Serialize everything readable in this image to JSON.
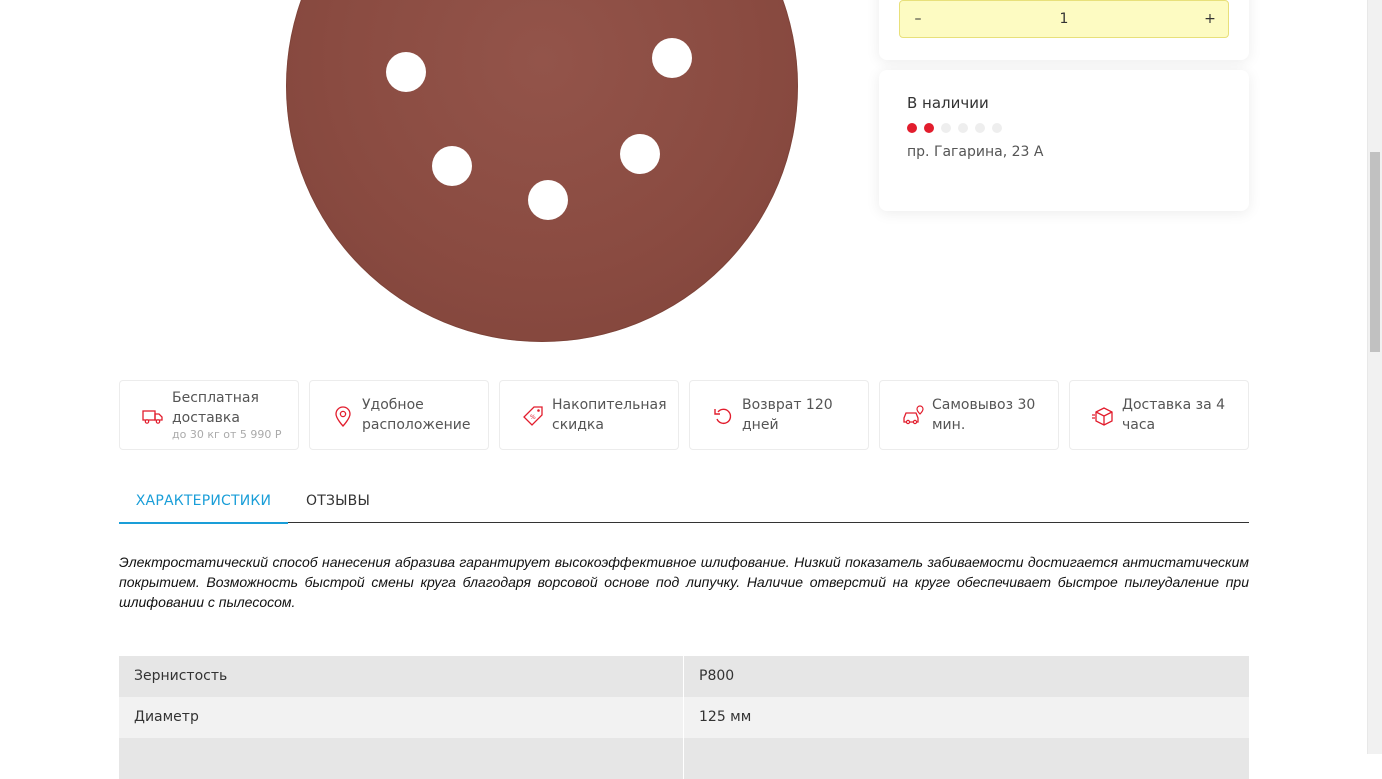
{
  "quantity": {
    "minus_label": "–",
    "value": "1",
    "plus_label": "+"
  },
  "stock": {
    "title": "В наличии",
    "level_filled": 2,
    "level_total": 6,
    "address": "пр. Гагарина, 23 А",
    "colors": {
      "filled": "#e21d2d",
      "empty": "#eeeeee"
    }
  },
  "benefits": [
    {
      "icon": "delivery-truck-icon",
      "label": "Бесплатная доставка",
      "sub": "до 30 кг от 5 990 Р"
    },
    {
      "icon": "location-pin-icon",
      "label": "Удобное расположение",
      "sub": ""
    },
    {
      "icon": "discount-tag-icon",
      "label": "Накопительная скидка",
      "sub": ""
    },
    {
      "icon": "return-arrow-icon",
      "label": "Возврат 120 дней",
      "sub": ""
    },
    {
      "icon": "car-pickup-icon",
      "label": "Самовывоз 30 мин.",
      "sub": ""
    },
    {
      "icon": "box-delivery-icon",
      "label": "Доставка за 4 часа",
      "sub": ""
    }
  ],
  "tabs": [
    {
      "label": "ХАРАКТЕРИСТИКИ",
      "active": true
    },
    {
      "label": "ОТЗЫВЫ",
      "active": false
    }
  ],
  "description": "Электростатический способ нанесения абразива гарантирует высокоэффективное шлифование. Низкий показатель забиваемости достигается антистатическим покрытием. Возможность быстрой смены круга благодаря ворсовой основе под липучку. Наличие отверстий на круге обеспечивает быстрое пылеудаление при шлифовании с пылесосом.",
  "specs": [
    {
      "name": "Зернистость",
      "value": "P800"
    },
    {
      "name": "Диаметр",
      "value": "125 мм"
    }
  ],
  "colors": {
    "accent": "#1a9ed8",
    "icon_red": "#e21d2d",
    "stepper_bg": "#fdfbc2"
  }
}
